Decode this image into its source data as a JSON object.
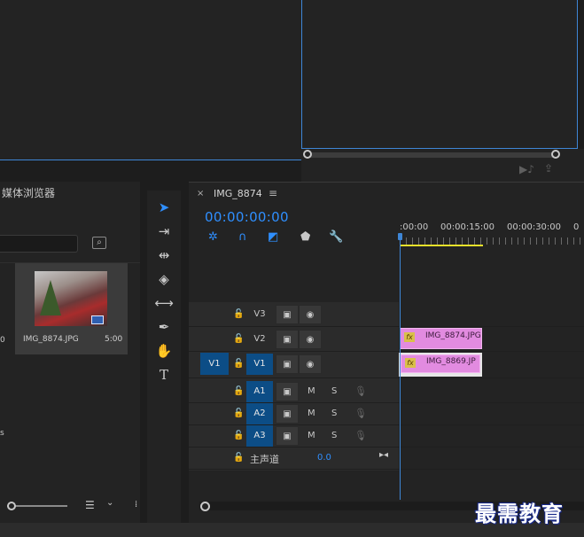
{
  "media_browser": {
    "title": "媒体浏览器",
    "thumb_name": "IMG_8874.JPG",
    "thumb_duration": "5:00",
    "left_fragments": [
      "0",
      "s"
    ],
    "view_icon": "list-icon",
    "chevron_icon": "chevron-down-icon"
  },
  "tools": [
    "selection-tool-icon",
    "track-select-tool-icon",
    "ripple-edit-tool-icon",
    "razor-tool-icon",
    "slip-tool-icon",
    "pen-tool-icon",
    "hand-tool-icon",
    "type-tool-icon"
  ],
  "timeline": {
    "close_glyph": "×",
    "tab_label": "IMG_8874",
    "menu_glyph": "≡",
    "timecode": "00:00:00:00",
    "ruler_labels": [
      ":00:00",
      "00:00:15:00",
      "00:00:30:00"
    ],
    "tracks_video": [
      {
        "label": "V3",
        "selected": false
      },
      {
        "label": "V2",
        "selected": false
      },
      {
        "label": "V1",
        "selected": true
      }
    ],
    "source_v1": "V1",
    "tracks_audio": [
      {
        "label": "A1",
        "m": "M",
        "s": "S"
      },
      {
        "label": "A2",
        "m": "M",
        "s": "S"
      },
      {
        "label": "A3",
        "m": "M",
        "s": "S"
      }
    ],
    "master_label": "主声道",
    "master_value": "0.0",
    "clips": [
      {
        "fx": "fx",
        "name": "IMG_8874.JPG"
      },
      {
        "fx": "fx",
        "name": "IMG_8869.JP"
      }
    ]
  },
  "watermark": "最需教育"
}
